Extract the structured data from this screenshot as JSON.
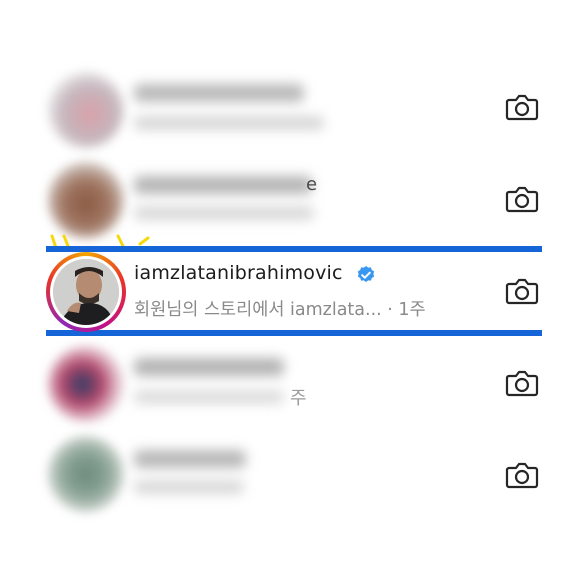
{
  "rows": [
    {
      "name": "",
      "sub": "",
      "blurred": true
    },
    {
      "name": "",
      "sub": "",
      "blurred": true,
      "stray_char": "e"
    },
    {
      "name": "iamzlatanibrahimovic",
      "sub": "회원님의 스토리에서 iamzlata... · 1주",
      "verified": true,
      "highlighted": true
    },
    {
      "name": "",
      "sub": "",
      "blurred": true,
      "stray_char": "주"
    },
    {
      "name": "",
      "sub": "",
      "blurred": true
    }
  ],
  "icons": {
    "camera": "camera-icon",
    "verified": "verified-badge-icon"
  },
  "colors": {
    "highlight": "#1565d8",
    "verified": "#3897f0",
    "doodle": "#f5d90a"
  }
}
